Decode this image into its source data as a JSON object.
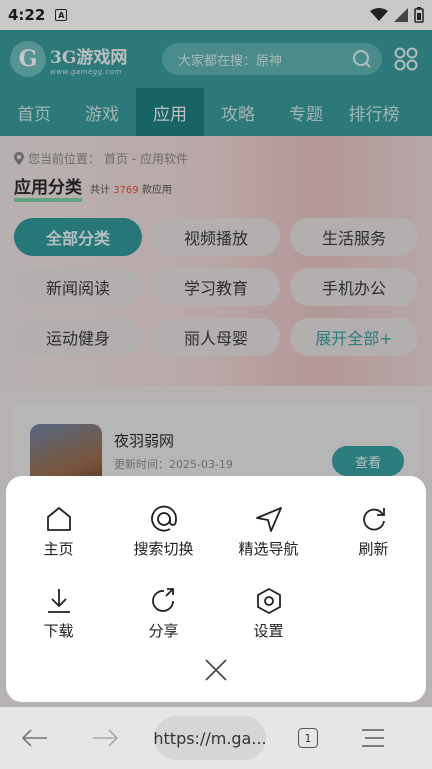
{
  "status_bar": {
    "time": "4:22",
    "notification_badge": "A"
  },
  "header": {
    "logo_name": "3G游戏网",
    "logo_url": "www.gamegg.com",
    "search_placeholder": "大家都在搜：原神"
  },
  "nav": {
    "items": [
      {
        "label": "首页"
      },
      {
        "label": "游戏"
      },
      {
        "label": "应用",
        "active": true
      },
      {
        "label": "攻略"
      },
      {
        "label": "专题"
      },
      {
        "label": "排行榜"
      }
    ]
  },
  "breadcrumb": {
    "prefix": "您当前位置：",
    "path": "首页 - 应用软件"
  },
  "category": {
    "title": "应用分类",
    "count_prefix": "共计",
    "count": "3769",
    "count_suffix": "款应用",
    "chips": [
      {
        "label": "全部分类",
        "active": true
      },
      {
        "label": "视频播放"
      },
      {
        "label": "生活服务"
      },
      {
        "label": "新闻阅读"
      },
      {
        "label": "学习教育"
      },
      {
        "label": "手机办公"
      },
      {
        "label": "运动健身"
      },
      {
        "label": "丽人母婴"
      },
      {
        "label": "展开全部+"
      }
    ]
  },
  "app_card": {
    "name": "夜羽弱网",
    "update_time": "更新时间：2025-03-19",
    "button": "查看"
  },
  "menu": {
    "items": [
      {
        "label": "主页",
        "icon": "home-icon"
      },
      {
        "label": "搜索切换",
        "icon": "at-icon"
      },
      {
        "label": "精选导航",
        "icon": "navigation-icon"
      },
      {
        "label": "刷新",
        "icon": "refresh-icon"
      },
      {
        "label": "下载",
        "icon": "download-icon"
      },
      {
        "label": "分享",
        "icon": "share-icon"
      },
      {
        "label": "设置",
        "icon": "settings-icon"
      }
    ],
    "close_icon": "close-icon"
  },
  "browser": {
    "url": "https://m.ga...",
    "tab_count": "1"
  },
  "colors": {
    "brand": "#3a9a9b",
    "brand_dark": "#1f7f81",
    "accent_orange": "#e2502f"
  }
}
